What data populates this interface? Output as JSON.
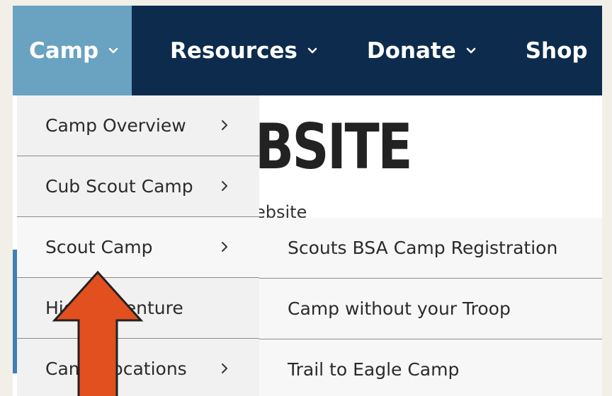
{
  "nav": {
    "items": [
      {
        "label": "Camp",
        "has_dropdown": true,
        "active": true
      },
      {
        "label": "Resources",
        "has_dropdown": true
      },
      {
        "label": "Donate",
        "has_dropdown": true
      },
      {
        "label": "Shop",
        "has_dropdown": false
      }
    ]
  },
  "background": {
    "title_fragment": "BSITE",
    "subtitle_fragment": "ebsite"
  },
  "menu": {
    "items": [
      {
        "label": "Camp Overview",
        "has_submenu": true
      },
      {
        "label": "Cub Scout Camp",
        "has_submenu": true
      },
      {
        "label": "Scout Camp",
        "has_submenu": true,
        "active": true
      },
      {
        "label": "High Adventure",
        "has_submenu": false
      },
      {
        "label": "Camp Locations",
        "has_submenu": true
      }
    ]
  },
  "submenu": {
    "items": [
      {
        "label": "Scouts BSA Camp Registration"
      },
      {
        "label": "Camp without your Troop"
      },
      {
        "label": "Trail to Eagle Camp"
      }
    ]
  },
  "colors": {
    "nav_bg": "#0d2c4d",
    "nav_active": "#6aa2c2",
    "menu_bg": "#f1f1f1",
    "annotation_arrow": "#e2501f"
  }
}
